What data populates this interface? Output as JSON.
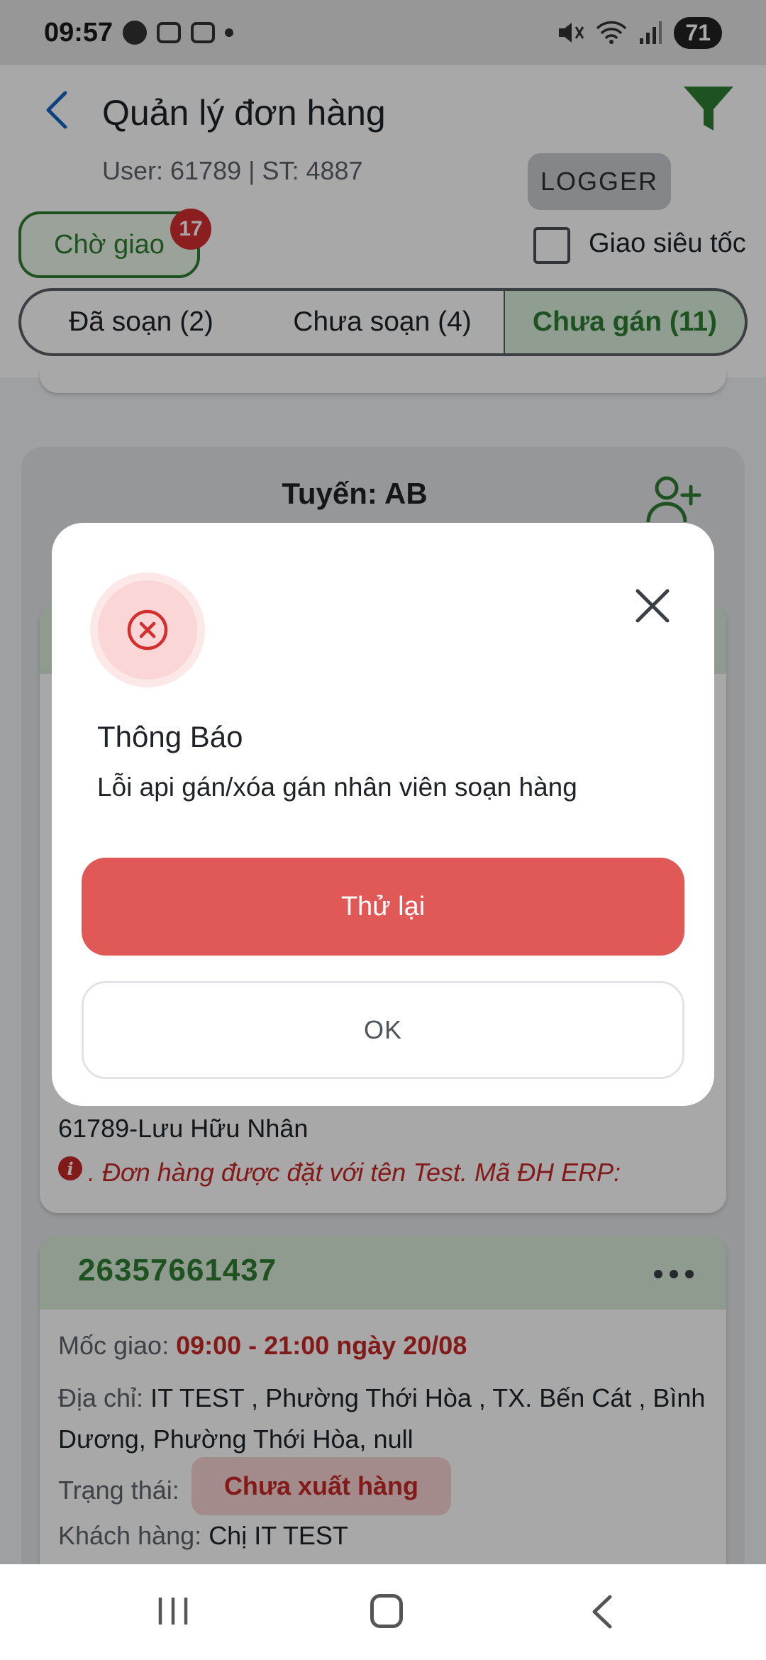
{
  "status_bar": {
    "time": "09:57",
    "battery": "71"
  },
  "header": {
    "title": "Quản lý đơn hàng",
    "subtitle": "User: 61789 | ST: 4887",
    "logger_label": "LOGGER",
    "pending_chip_label": "Chờ giao",
    "pending_badge": "17",
    "express_label": "Giao siêu tốc",
    "express_checked": false,
    "tabs": [
      {
        "label": "Đã soạn (2)",
        "selected": false
      },
      {
        "label": "Chưa soạn (4)",
        "selected": false
      },
      {
        "label": "Chưa gán (11)",
        "selected": true
      }
    ]
  },
  "group": {
    "route_title": "Tuyến: AB",
    "order1": {
      "assignee": "61789-Lưu Hữu Nhân",
      "note": ". Đơn hàng được đặt với tên Test. Mã ĐH ERP:"
    },
    "order2": {
      "id": "26357661437",
      "delivery_label": "Mốc giao:",
      "delivery_value": "09:00 - 21:00 ngày 20/08",
      "address_label": "Địa chỉ:",
      "address_value": "IT TEST , Phường Thới Hòa , TX. Bến Cát , Bình Dương, Phường Thới Hòa, null",
      "status_label": "Trạng thái:",
      "status_value": "Chưa xuất hàng",
      "customer_label": "Khách hàng:",
      "customer_value": "Chị IT TEST"
    }
  },
  "dialog": {
    "title": "Thông Báo",
    "message": "Lỗi api gán/xóa gán nhân viên soạn hàng",
    "retry_label": "Thử lại",
    "ok_label": "OK"
  },
  "colors": {
    "accent_green": "#2e7d32",
    "error_red": "#c62828",
    "retry_red": "#e05956"
  }
}
